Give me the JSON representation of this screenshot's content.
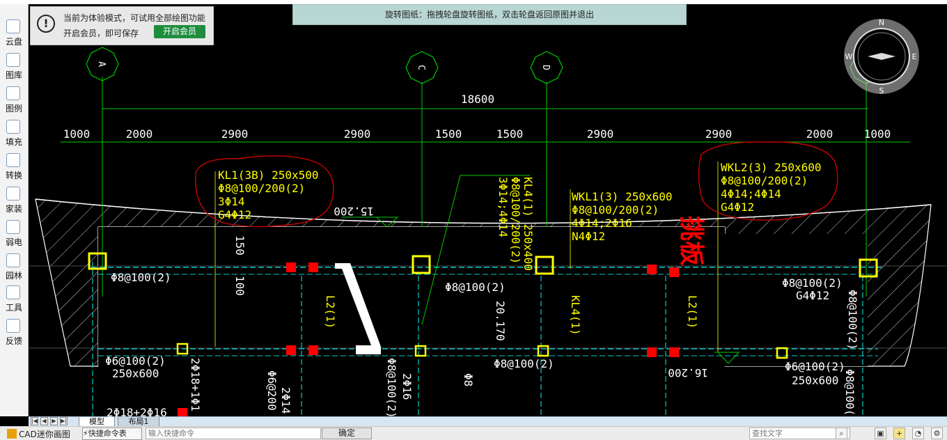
{
  "toolbar": {
    "items": [
      {
        "label": "云盘",
        "icon": "cloud-icon"
      },
      {
        "label": "图库",
        "icon": "gallery-icon"
      },
      {
        "label": "图例",
        "icon": "legend-icon"
      },
      {
        "label": "填充",
        "icon": "hatch-fill-icon"
      },
      {
        "label": "转换",
        "icon": "convert-icon"
      },
      {
        "label": "家装",
        "icon": "home-decor-icon"
      },
      {
        "label": "弱电",
        "icon": "low-voltage-icon"
      },
      {
        "label": "园林",
        "icon": "landscape-icon"
      },
      {
        "label": "工具",
        "icon": "tools-icon"
      },
      {
        "label": "反馈",
        "icon": "feedback-icon"
      }
    ]
  },
  "trial_banner": {
    "line1": "当前为体验模式，可试用全部绘图功能",
    "line2": "开启会员，即可保存",
    "button": "开启会员",
    "icon": "exclamation-icon"
  },
  "rotate_hint": "旋转图纸：拖拽轮盘旋转图纸，双击轮盘返回原图并退出",
  "compass": {
    "icon": "rotate-compass-icon",
    "letters": [
      "N",
      "E",
      "S",
      "W"
    ]
  },
  "drawing": {
    "axis_labels": [
      "A",
      "C",
      "D"
    ],
    "total_dimension": "18600",
    "dimensions": [
      "1000",
      "2000",
      "2900",
      "2900",
      "1500",
      "1500",
      "2900",
      "2900",
      "2000",
      "1000"
    ],
    "annotations": {
      "kl1": [
        "KL1(3B) 250x500",
        "Φ8@100/200(2)",
        "3Φ14",
        "G4Φ12"
      ],
      "wkl2": [
        "WKL2(3) 250x600",
        "Φ8@100/200(2)",
        "4Φ14;4Φ14",
        "G4Φ12"
      ],
      "wkl1": [
        "WKL1(3) 250x600",
        "Φ8@100/200(2)",
        "4Φ14;2Φ16",
        "N4Φ12"
      ],
      "kl4_vertical": [
        "KL4(1) 250x400",
        "Φ8@100/200(2)",
        "3Φ14;4Φ14"
      ],
      "cantilever_slab": "挑板",
      "elev_15200": "15.200",
      "elev_16200": "16.200",
      "dim_150": "150",
      "dim_100": "100",
      "stirrup_1": "Φ8@100(2)",
      "stirrup_2": "Φ8@100(2)",
      "stirrup_3": "Φ8@100(2)",
      "stirrup_4": "Φ8@100(2)",
      "g4_right": "G4Φ12",
      "stirrup_vert_right": "Φ8@100(2)",
      "l2_a": "L2(1)",
      "l2_b": "L2(1)",
      "kl4_b": "KL4(1)",
      "elev_20170": "20.170",
      "beam_left_1": "Φ6@100(2)",
      "beam_left_2": "250x600",
      "beam_right_1": "Φ6@100(2)",
      "beam_right_2": "250x600",
      "rebar_a": "2Φ18+1Φ1",
      "rebar_b": "Φ6@200",
      "rebar_c": "2Φ14",
      "rebar_d": "Φ8@100(2)",
      "rebar_e": "2Φ16",
      "rebar_f": "Φ8",
      "rebar_g": "2Φ18+2Φ16",
      "rebar_h": "Φ8@100(2)"
    }
  },
  "tabs": {
    "model": "模型",
    "layout1": "布局1"
  },
  "status": {
    "app_name": "CAD迷你画图",
    "quick_cmd_label": "⚡快捷命令表",
    "quick_cmd_placeholder": "输入快捷命令",
    "ok_button": "确定",
    "search_placeholder": "查找文字"
  },
  "colors": {
    "canvas_bg": "#000000",
    "cad_yellow": "#ffff00",
    "cad_green": "#00cc00",
    "cad_cyan": "#00cccc",
    "cad_red": "#ff0000",
    "revision_cloud": "#cc0000",
    "vip_green": "#1e8e3e",
    "rotate_bar": "#b8d6d2"
  }
}
